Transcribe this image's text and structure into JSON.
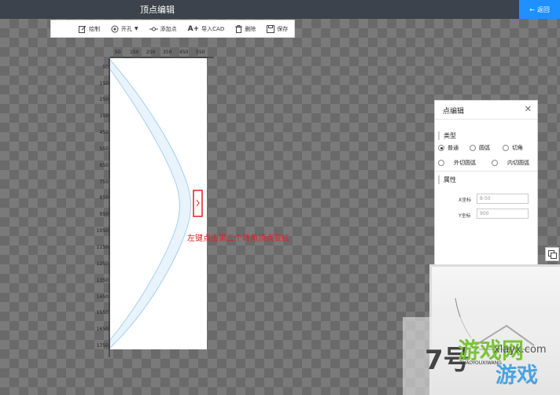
{
  "header": {
    "title": "顶点编辑",
    "back_label": "返回"
  },
  "toolbar": {
    "items": [
      {
        "label": "绘制",
        "icon": "edit-icon"
      },
      {
        "label": "开孔",
        "icon": "hole-icon"
      },
      {
        "label": "添加点",
        "icon": "add-point-icon"
      },
      {
        "label": "导入CAD",
        "icon": "import-cad-icon"
      },
      {
        "label": "删除",
        "icon": "trash-icon"
      },
      {
        "label": "保存",
        "icon": "save-icon"
      }
    ]
  },
  "ruler": {
    "x_ticks": [
      "50",
      "150",
      "250",
      "350",
      "450",
      "550"
    ],
    "y_ticks": [
      "50",
      "150",
      "250",
      "350",
      "450",
      "550",
      "650",
      "750",
      "850",
      "950",
      "1050",
      "1150",
      "1250",
      "1350",
      "1450",
      "1550",
      "1650",
      "1750"
    ]
  },
  "annotation": "左键点击第二个转角顶点变红",
  "panel": {
    "title": "点编辑",
    "type_label": "类型",
    "types": [
      {
        "label": "普通",
        "checked": true
      },
      {
        "label": "圆弧",
        "checked": false
      },
      {
        "label": "切角",
        "checked": false
      },
      {
        "label": "外切圆弧",
        "checked": false
      },
      {
        "label": "内切圆弧",
        "checked": false
      }
    ],
    "attr_label": "属性",
    "x_label": "X坐标",
    "x_value": "8-50",
    "y_label": "Y坐标",
    "y_value": "900"
  },
  "watermark": {
    "logo": "7号",
    "brand": "游戏网",
    "pinyin": "7HAOYOUXIWANG",
    "site": "xlayx.com",
    "game": "游戏"
  },
  "colors": {
    "topbar": "#3c434c",
    "accent": "#1e90ff",
    "highlight": "#e02020",
    "shape_line": "#8cc4ee"
  }
}
